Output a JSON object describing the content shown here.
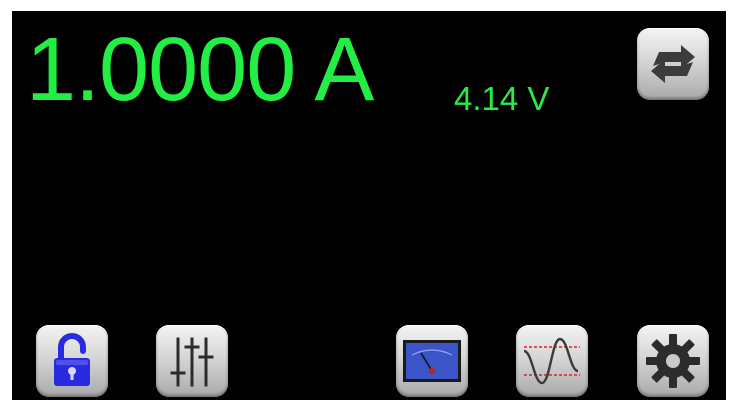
{
  "display": {
    "current": "1.0000 A",
    "voltage": "4.14 V"
  },
  "buttons": [
    {
      "id": "swap",
      "icon": "swap-arrows-icon"
    },
    {
      "id": "lock",
      "icon": "unlocked-padlock-icon"
    },
    {
      "id": "sliders",
      "icon": "sliders-icon"
    },
    {
      "id": "meter",
      "icon": "analog-meter-icon"
    },
    {
      "id": "wave",
      "icon": "sine-wave-icon"
    },
    {
      "id": "settings",
      "icon": "gear-icon"
    }
  ],
  "colors": {
    "readout": "#22ee44",
    "background": "#000000",
    "lock_blue": "#2a2ae0",
    "meter_blue": "#3a55c8",
    "wave_red": "#e02020"
  }
}
